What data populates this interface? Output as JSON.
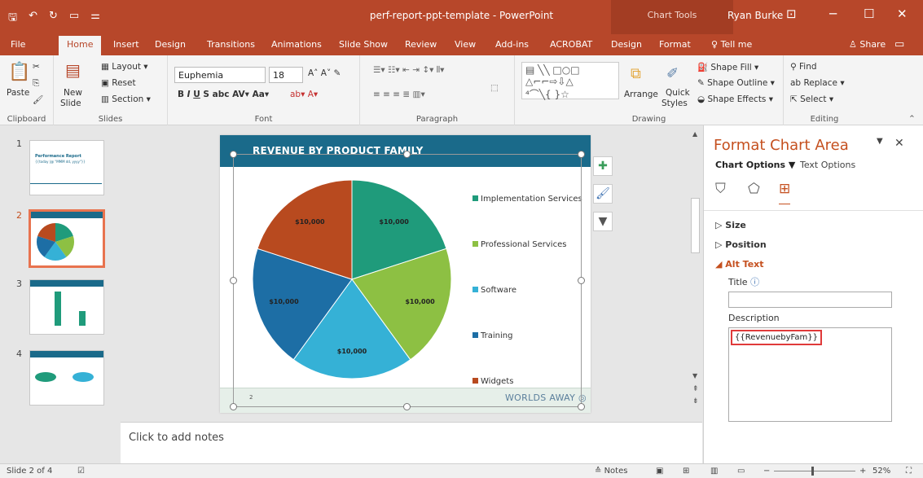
{
  "window": {
    "doc_title": "perf-report-ppt-template - PowerPoint",
    "context_label": "Chart Tools",
    "user": "Ryan Burke"
  },
  "tabs": {
    "file": "File",
    "home": "Home",
    "insert": "Insert",
    "design": "Design",
    "transitions": "Transitions",
    "animations": "Animations",
    "slideshow": "Slide Show",
    "review": "Review",
    "view": "View",
    "addins": "Add-ins",
    "acrobat": "ACROBAT",
    "ctx_design": "Design",
    "ctx_format": "Format",
    "tellme": "Tell me",
    "share": "Share"
  },
  "ribbon": {
    "paste": "Paste",
    "new_slide_1": "New",
    "new_slide_2": "Slide",
    "layout": "Layout",
    "reset": "Reset",
    "section": "Section",
    "font_name": "Euphemia",
    "font_size": "18",
    "arrange": "Arrange",
    "quick_styles_1": "Quick",
    "quick_styles_2": "Styles",
    "shape_fill": "Shape Fill",
    "shape_outline": "Shape Outline",
    "shape_effects": "Shape Effects",
    "find": "Find",
    "replace": "Replace",
    "select": "Select",
    "groups": {
      "clipboard": "Clipboard",
      "slides": "Slides",
      "font": "Font",
      "paragraph": "Paragraph",
      "drawing": "Drawing",
      "editing": "Editing"
    }
  },
  "thumbnails": [
    {
      "num": "1",
      "title": "Performance Report",
      "subtitle": "{{today |@ \"MMM dd, yyyy\"}}"
    },
    {
      "num": "2"
    },
    {
      "num": "3"
    },
    {
      "num": "4"
    }
  ],
  "slide": {
    "title": "REVENUE BY PRODUCT FAMILY",
    "number": "2",
    "logo": "WORLDS AWAY"
  },
  "chart_data": {
    "type": "pie",
    "title": "",
    "series": [
      {
        "name": "Implementation Services",
        "value": 10000,
        "label": "$10,000",
        "color": "#1f9b7b"
      },
      {
        "name": "Professional Services",
        "value": 10000,
        "label": "$10,000",
        "color": "#8dc043"
      },
      {
        "name": "Software",
        "value": 10000,
        "label": "$10,000",
        "color": "#35b1d6"
      },
      {
        "name": "Training",
        "value": 10000,
        "label": "$10,000",
        "color": "#1d6ea5"
      },
      {
        "name": "Widgets",
        "value": 10000,
        "label": "$10,000",
        "color": "#b84a1f"
      }
    ],
    "legend": "right"
  },
  "notes": {
    "placeholder": "Click to add notes"
  },
  "pane": {
    "title": "Format Chart Area",
    "tab_chart_options": "Chart Options",
    "tab_text_options": "Text Options",
    "section_size": "Size",
    "section_position": "Position",
    "section_alt_text": "Alt Text",
    "title_label": "Title",
    "title_value": "",
    "description_label": "Description",
    "description_value": "{{RevenuebyFam}}"
  },
  "status": {
    "slide_info": "Slide 2 of 4",
    "notes": "Notes",
    "zoom": "52%"
  }
}
